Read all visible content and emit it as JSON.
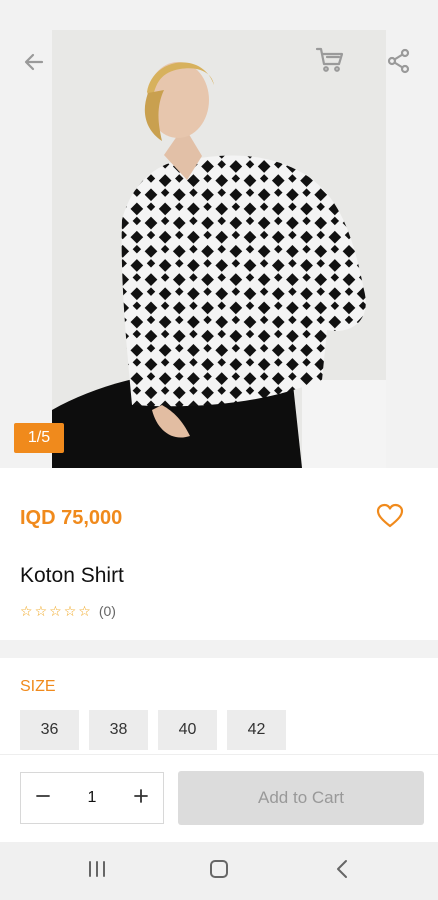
{
  "header": {
    "back_icon": "arrow-left-icon",
    "cart_icon": "cart-icon",
    "share_icon": "share-icon"
  },
  "gallery": {
    "counter": "1/5",
    "image": "product-photo"
  },
  "product": {
    "price": "IQD 75,000",
    "title": "Koton Shirt",
    "rating": 0,
    "rating_count": "(0)",
    "favorite_icon": "heart-outline-icon"
  },
  "size": {
    "label": "SIZE",
    "options": [
      "36",
      "38",
      "40",
      "42"
    ]
  },
  "purchase": {
    "quantity": "1",
    "add_to_cart": "Add to Cart"
  },
  "system_nav": {
    "recents_icon": "recents-icon",
    "home_icon": "home-icon",
    "back_icon": "back-icon"
  },
  "colors": {
    "accent": "#f08a1c",
    "star": "#f0a51c",
    "disabled_button": "#dcdcdc"
  }
}
